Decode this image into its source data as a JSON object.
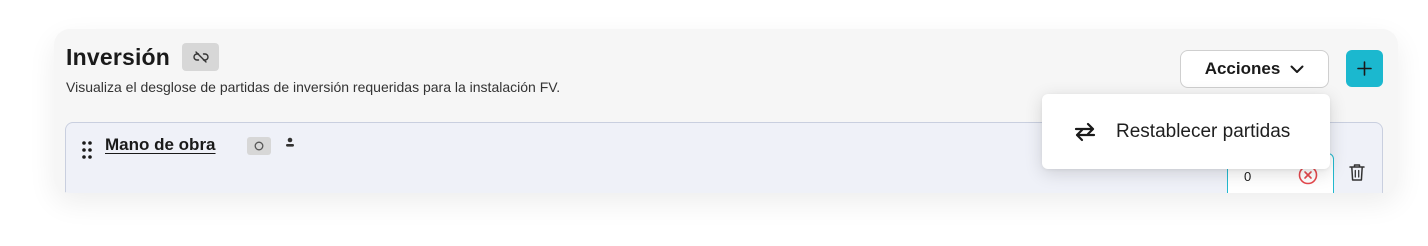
{
  "section": {
    "title": "Inversión",
    "subtitle": "Visualiza el desglose de partidas de inversión requeridas para la instalación FV."
  },
  "toolbar": {
    "actions_label": "Acciones"
  },
  "dropdown": {
    "items": [
      {
        "label": "Restablecer partidas",
        "icon": "swap-arrows-icon"
      }
    ]
  },
  "row": {
    "title": "Mano de obra",
    "quantity": "0"
  },
  "colors": {
    "accent": "#1bb8cf",
    "card_bg": "#f6f6f6",
    "row_bg": "#eff1f8",
    "danger": "#e5484d"
  }
}
